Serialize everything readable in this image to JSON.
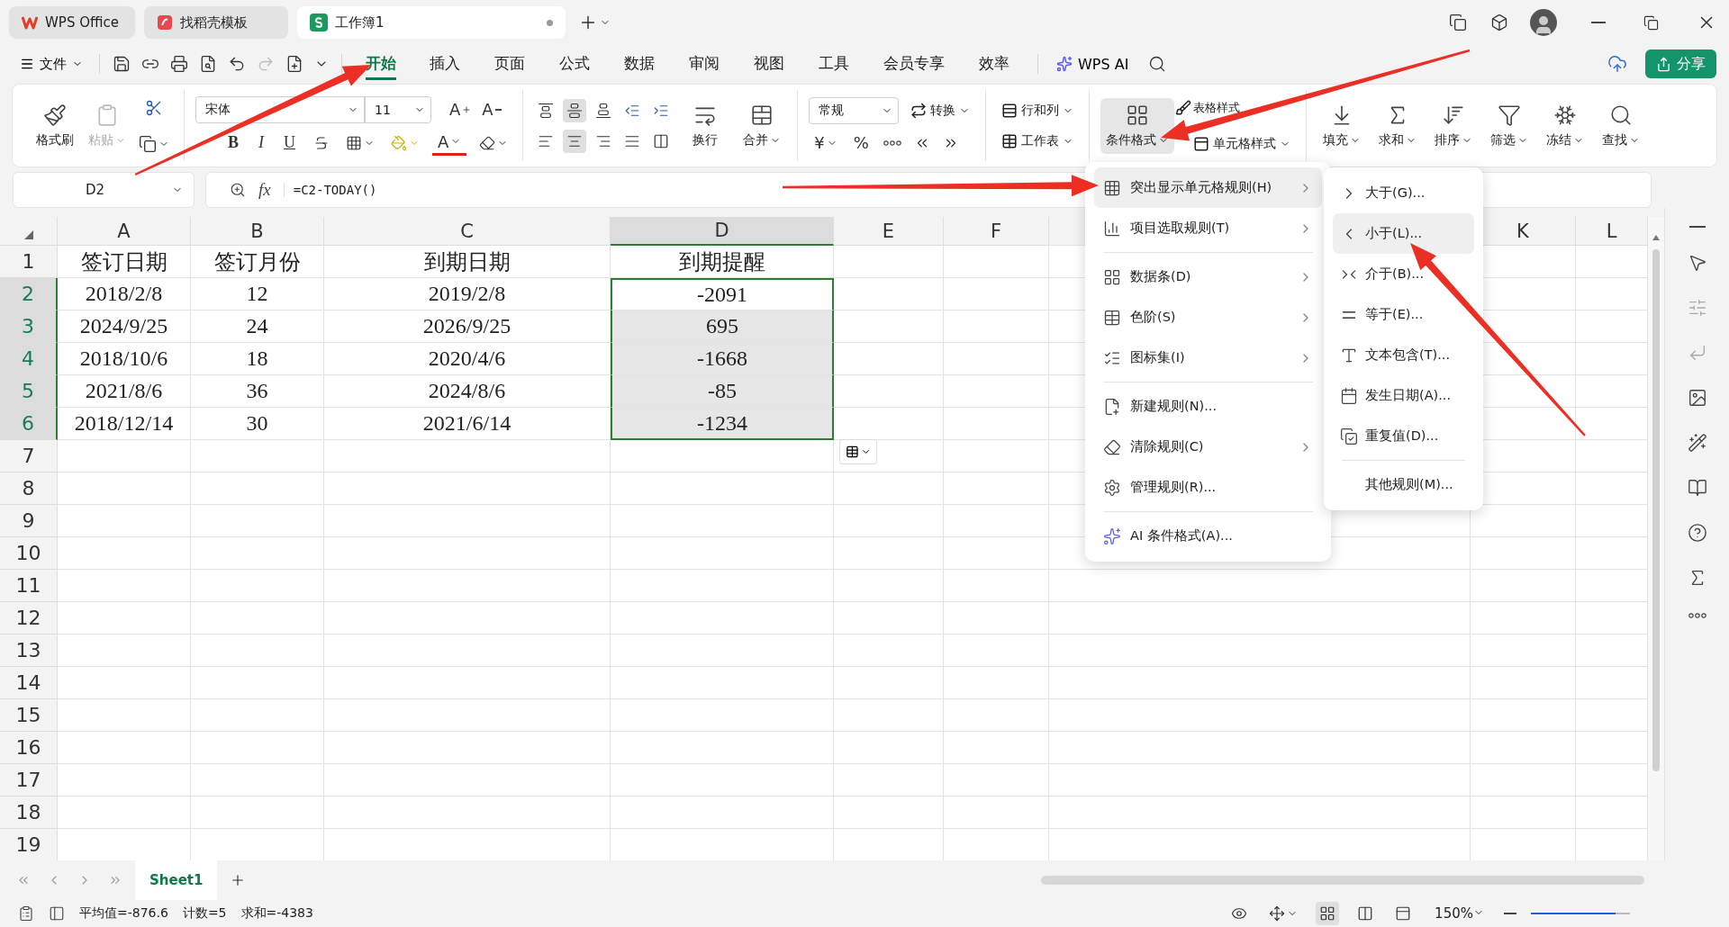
{
  "title_tabs": [
    {
      "label": "WPS Office",
      "kind": "home",
      "selected": false
    },
    {
      "label": "找稻壳模板",
      "kind": "template",
      "selected": false
    },
    {
      "label": "工作簿1",
      "kind": "sheet",
      "selected": true,
      "modified": true
    }
  ],
  "menu_bar": {
    "file": "文件",
    "tabs": [
      {
        "label": "开始",
        "selected": true
      },
      {
        "label": "插入",
        "selected": false
      },
      {
        "label": "页面",
        "selected": false
      },
      {
        "label": "公式",
        "selected": false
      },
      {
        "label": "数据",
        "selected": false
      },
      {
        "label": "审阅",
        "selected": false
      },
      {
        "label": "视图",
        "selected": false
      },
      {
        "label": "工具",
        "selected": false
      },
      {
        "label": "会员专享",
        "selected": false
      },
      {
        "label": "效率",
        "selected": false
      }
    ],
    "ai": "WPS AI",
    "share": "分享"
  },
  "ribbon": {
    "format_painter": "格式刷",
    "paste": {
      "label": "粘贴",
      "disabled": true
    },
    "font": {
      "name": "宋体",
      "size": "11",
      "grow": "A",
      "shrink": "A",
      "styles": [
        "B",
        "I",
        "U"
      ],
      "font_color": "A"
    },
    "valign": [
      {
        "selected": false
      },
      {
        "selected": true
      },
      {
        "selected": false
      }
    ],
    "halign": [
      {
        "selected": false
      },
      {
        "selected": true
      },
      {
        "selected": false
      },
      {
        "selected": false
      }
    ],
    "wrap": "换行",
    "merge": "合并",
    "number": {
      "format": "常规",
      "convert": "转换",
      "currency": "¥",
      "percent": "%"
    },
    "rows_cols": "行和列",
    "worksheet": "工作表",
    "conditional": {
      "label": "条件格式",
      "selected": true
    },
    "table_style": "表格样式",
    "cell_style": "单元格样式",
    "edit": [
      "填充",
      "求和",
      "排序",
      "筛选",
      "冻结",
      "查找"
    ]
  },
  "formula_bar": {
    "name_box": "D2",
    "fx": "fx",
    "formula": "=C2-TODAY()"
  },
  "sheet": {
    "columns": [
      {
        "label": "A",
        "selected": false
      },
      {
        "label": "B",
        "selected": false
      },
      {
        "label": "C",
        "selected": false
      },
      {
        "label": "D",
        "selected": true
      },
      {
        "label": "E",
        "selected": false
      },
      {
        "label": "F",
        "selected": false
      },
      {
        "label": "K",
        "selected": false
      },
      {
        "label": "L",
        "selected": false
      }
    ],
    "rows": [
      {
        "label": "1",
        "selected": false,
        "cells": [
          "签订日期",
          "签订月份",
          "到期日期",
          "到期提醒"
        ]
      },
      {
        "label": "2",
        "selected": true,
        "cells": [
          "2018/2/8",
          "12",
          "2019/2/8",
          "-2091"
        ]
      },
      {
        "label": "3",
        "selected": true,
        "cells": [
          "2024/9/25",
          "24",
          "2026/9/25",
          "695"
        ]
      },
      {
        "label": "4",
        "selected": true,
        "cells": [
          "2018/10/6",
          "18",
          "2020/4/6",
          "-1668"
        ]
      },
      {
        "label": "5",
        "selected": true,
        "cells": [
          "2021/8/6",
          "36",
          "2024/8/6",
          "-85"
        ]
      },
      {
        "label": "6",
        "selected": true,
        "cells": [
          "2018/12/14",
          "30",
          "2021/6/14",
          "-1234"
        ]
      },
      {
        "label": "7",
        "selected": false,
        "cells": []
      },
      {
        "label": "8",
        "selected": false,
        "cells": []
      },
      {
        "label": "9",
        "selected": false,
        "cells": []
      },
      {
        "label": "10",
        "selected": false,
        "cells": []
      },
      {
        "label": "11",
        "selected": false,
        "cells": []
      },
      {
        "label": "12",
        "selected": false,
        "cells": []
      },
      {
        "label": "13",
        "selected": false,
        "cells": []
      },
      {
        "label": "14",
        "selected": false,
        "cells": []
      },
      {
        "label": "15",
        "selected": false,
        "cells": []
      },
      {
        "label": "16",
        "selected": false,
        "cells": []
      },
      {
        "label": "17",
        "selected": false,
        "cells": []
      },
      {
        "label": "18",
        "selected": false,
        "cells": []
      },
      {
        "label": "19",
        "selected": false,
        "cells": []
      }
    ]
  },
  "context_menu": {
    "groups": [
      [
        {
          "label": "突出显示单元格规则(H)",
          "submenu": true,
          "selected": true
        },
        {
          "label": "项目选取规则(T)",
          "submenu": true,
          "selected": false
        }
      ],
      [
        {
          "label": "数据条(D)",
          "submenu": true,
          "selected": false
        },
        {
          "label": "色阶(S)",
          "submenu": true,
          "selected": false
        },
        {
          "label": "图标集(I)",
          "submenu": true,
          "selected": false
        }
      ],
      [
        {
          "label": "新建规则(N)...",
          "submenu": false,
          "selected": false
        },
        {
          "label": "清除规则(C)",
          "submenu": true,
          "selected": false
        },
        {
          "label": "管理规则(R)...",
          "submenu": false,
          "selected": false
        }
      ],
      [
        {
          "label": "AI 条件格式(A)...",
          "submenu": false,
          "selected": false
        }
      ]
    ]
  },
  "submenu": {
    "items": [
      {
        "label": "大于(G)...",
        "selected": false
      },
      {
        "label": "小于(L)...",
        "selected": true
      },
      {
        "label": "介于(B)...",
        "selected": false
      },
      {
        "label": "等于(E)...",
        "selected": false
      },
      {
        "label": "文本包含(T)...",
        "selected": false
      },
      {
        "label": "发生日期(A)...",
        "selected": false
      },
      {
        "label": "重复值(D)...",
        "selected": false
      }
    ],
    "footer": "其他规则(M)..."
  },
  "sheet_tabs": [
    {
      "label": "Sheet1",
      "selected": true
    }
  ],
  "status_bar": {
    "stats": [
      "平均值=-876.6",
      "计数=5",
      "求和=-4383"
    ],
    "views": [
      {
        "selected": true
      },
      {
        "selected": false
      },
      {
        "selected": false
      }
    ],
    "zoom": "150%",
    "zoom_slider": {
      "level": 0.85
    }
  }
}
